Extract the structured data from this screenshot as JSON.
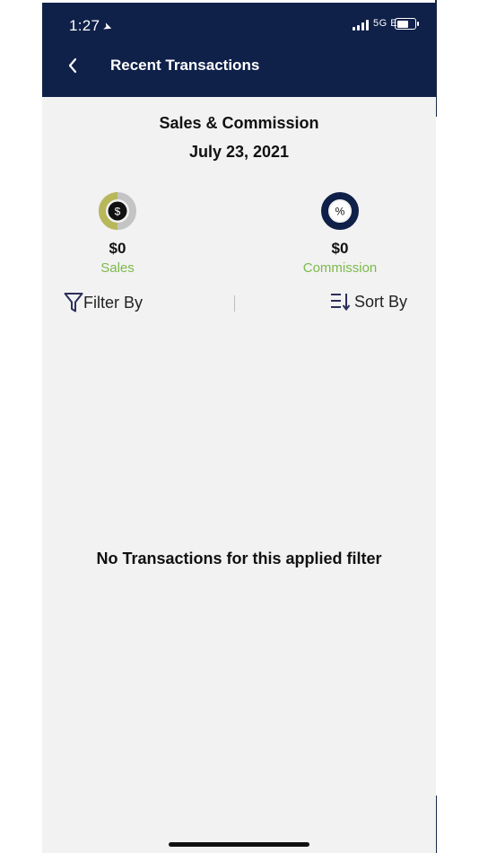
{
  "status_bar": {
    "time": "1:27",
    "network": "5G E"
  },
  "header": {
    "title": "Recent Transactions",
    "back_icon": "chevron-left-icon",
    "background": "#0f2049"
  },
  "report": {
    "title": "Sales & Commission",
    "date": "July 23, 2021"
  },
  "stats": {
    "sales": {
      "amount": "$0",
      "label": "Sales",
      "symbol": "$"
    },
    "commission": {
      "amount": "$0",
      "label": "Commission",
      "symbol": "%"
    }
  },
  "toolbar": {
    "filter_label": "Filter By",
    "sort_label": "Sort By"
  },
  "empty_state": {
    "message": "No Transactions for this applied filter"
  },
  "colors": {
    "accent_green": "#7cba4a",
    "navy": "#0f2049",
    "olive": "#b8b85a"
  }
}
